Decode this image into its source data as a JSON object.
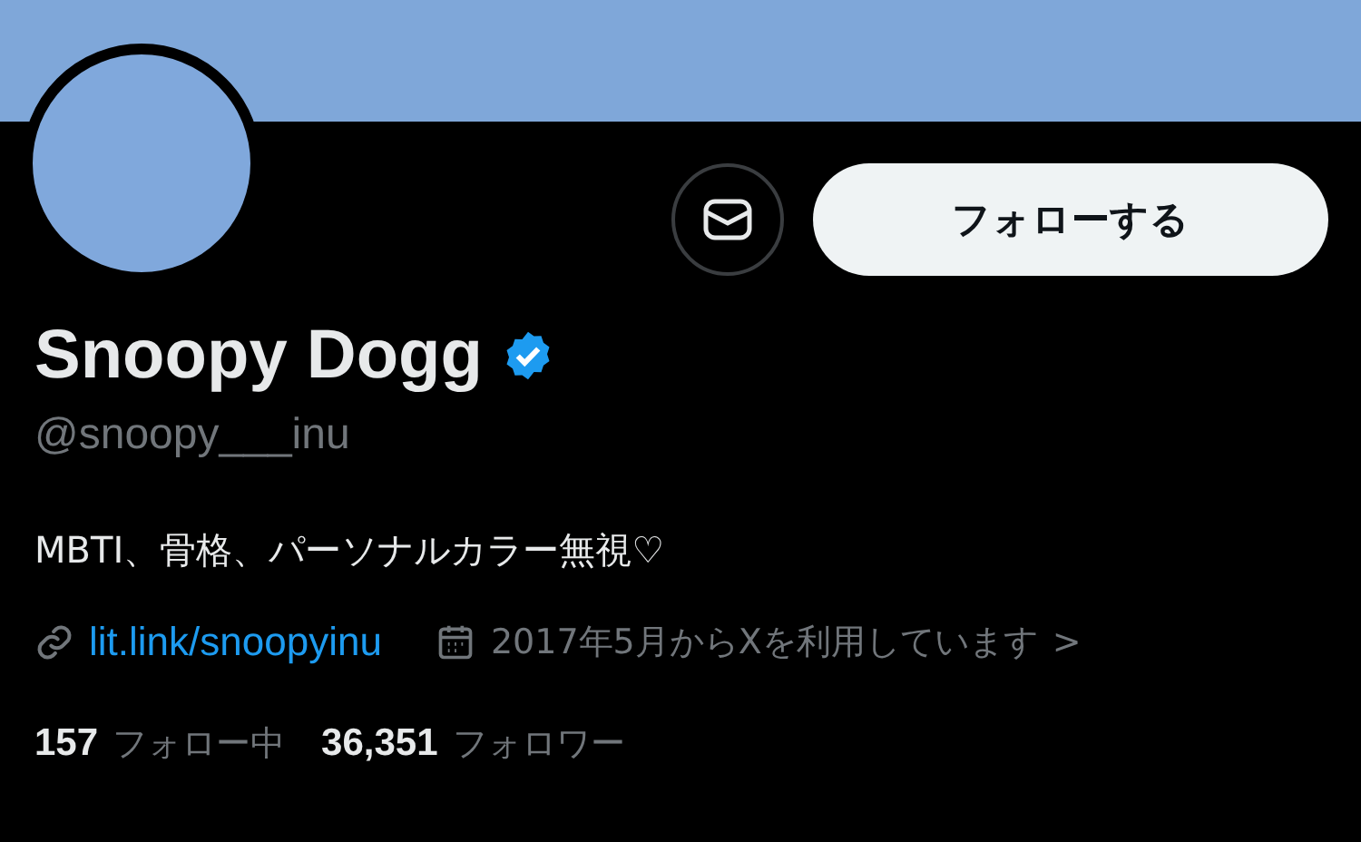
{
  "profile": {
    "name": "Snoopy Dogg",
    "verified": true,
    "handle": "@snoopy___inu",
    "bio": "MBTI、骨格、パーソナルカラー無視♡"
  },
  "actions": {
    "follow_label": "フォローする"
  },
  "info": {
    "link": "lit.link/snoopyinu",
    "joined": "2017年5月からXを利用しています",
    "joined_chevron": ">"
  },
  "stats": [
    {
      "count": "157",
      "label": "フォロー中"
    },
    {
      "count": "36,351",
      "label": "フォロワー"
    }
  ]
}
